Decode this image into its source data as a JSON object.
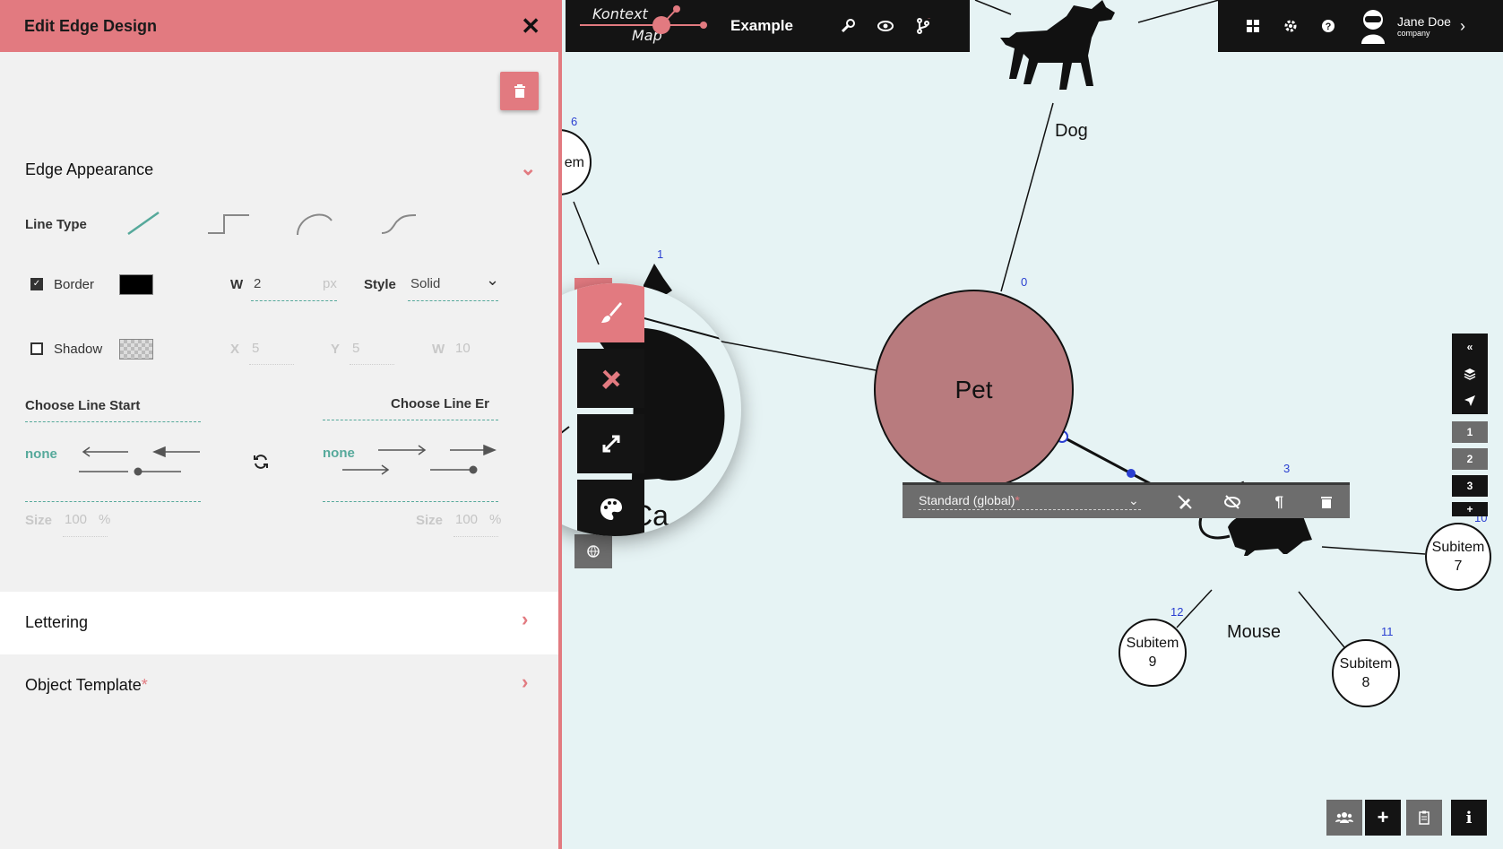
{
  "panel": {
    "title": "Edit Edge Design",
    "sections": {
      "edge_appearance": "Edge Appearance",
      "lettering": "Lettering",
      "object_template": "Object Template",
      "object_template_required_mark": "*"
    },
    "line_type": {
      "label": "Line Type",
      "options": [
        "straight",
        "orthogonal",
        "curved",
        "s-curve"
      ],
      "selected": "straight"
    },
    "border": {
      "label": "Border",
      "checked": true,
      "color": "#000000",
      "width_label": "W",
      "width_value": "2",
      "width_unit": "px",
      "style_label": "Style",
      "style_value": "Solid"
    },
    "shadow": {
      "label": "Shadow",
      "checked": false,
      "x_label": "X",
      "x_value": "5",
      "y_label": "Y",
      "y_value": "5",
      "w_label": "W",
      "w_value": "10"
    },
    "line_start": {
      "label": "Choose Line Start",
      "selected": "none",
      "size_label": "Size",
      "size_value": "100",
      "size_unit": "%"
    },
    "line_end": {
      "label": "Choose Line End",
      "visible_label": "Choose Line Er",
      "selected": "none",
      "size_label": "Size",
      "size_value": "100",
      "size_unit": "%"
    }
  },
  "topbar": {
    "logo_line1": "Kontext",
    "logo_line2": "Map",
    "map_name": "Example",
    "user_name": "Jane Doe",
    "user_company": "company"
  },
  "canvas": {
    "nodes": {
      "pet": {
        "label": "Pet",
        "num": "0"
      },
      "dog": {
        "label": "Dog"
      },
      "mouse": {
        "label": "Mouse",
        "num": "3"
      },
      "cat": {
        "num": "1",
        "partial_label": "Ca"
      },
      "left_partial": {
        "num": "6",
        "partial_label": "em"
      },
      "subitem7": {
        "line1": "Subitem",
        "line2": "7",
        "num": "10"
      },
      "subitem8": {
        "line1": "Subitem",
        "line2": "8",
        "num": "11"
      },
      "subitem9": {
        "line1": "Subitem",
        "line2": "9",
        "num": "12"
      }
    }
  },
  "edge_toolbar": {
    "design_select": "Standard (global)",
    "required_mark": "*"
  },
  "right_controls": {
    "levels": [
      "1",
      "2",
      "3"
    ],
    "add": "+"
  },
  "colors": {
    "accent": "#e27a80",
    "panel_bg": "#f1f1f1",
    "canvas_bg": "#e6f3f4",
    "teal": "#56a99b",
    "dark": "#141414",
    "pet_fill": "#b87b7e"
  }
}
